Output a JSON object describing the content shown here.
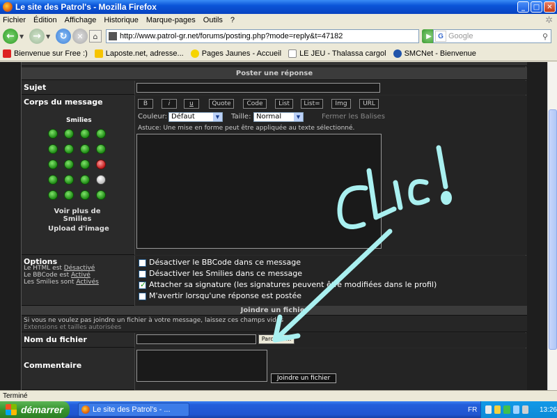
{
  "window": {
    "title": "Le site des Patrol's - Mozilla Firefox"
  },
  "menu": [
    "Fichier",
    "Édition",
    "Affichage",
    "Historique",
    "Marque-pages",
    "Outils",
    "?"
  ],
  "nav": {
    "url": "http://www.patrol-gr.net/forums/posting.php?mode=reply&t=47182",
    "search_placeholder": "Google"
  },
  "bookmarks": [
    {
      "label": "Bienvenue sur Free :)",
      "color": "#d22"
    },
    {
      "label": "Laposte.net, adresse...",
      "color": "#f6c400"
    },
    {
      "label": "Pages Jaunes - Accueil",
      "color": "#f6d400"
    },
    {
      "label": "LE JEU - Thalassa cargol",
      "color": "#eee"
    },
    {
      "label": "SMCNet - Bienvenue",
      "color": "#2255aa"
    }
  ],
  "form": {
    "header": "Poster une réponse",
    "subject_label": "Sujet",
    "body_label": "Corps du message",
    "smilies_title": "Smilies",
    "more_smilies": "Voir plus de Smilies",
    "upload_image": "Upload d'image",
    "bbcode_buttons": [
      "B",
      "i",
      "u",
      "Quote",
      "Code",
      "List",
      "List=",
      "Img",
      "URL"
    ],
    "color_label": "Couleur:",
    "color_value": "Défaut",
    "size_label": "Taille:",
    "size_value": "Normal",
    "close_tags": "Fermer les Balises",
    "tip": "Astuce: Une mise en forme peut être appliquée au texte sélectionné.",
    "options_label": "Options",
    "html_status_prefix": "Le HTML est",
    "html_status": "Désactivé",
    "bbcode_status_prefix": "Le BBCode est",
    "bbcode_status": "Activé",
    "smilies_status_prefix": "Les Smilies sont",
    "smilies_status": "Activés",
    "options": [
      {
        "label": "Désactiver le BBCode dans ce message",
        "checked": false
      },
      {
        "label": "Désactiver les Smilies dans ce message",
        "checked": false
      },
      {
        "label": "Attacher sa signature (les signatures peuvent être modifiées dans le profil)",
        "checked": true
      },
      {
        "label": "M'avertir lorsqu'une réponse est postée",
        "checked": false
      }
    ],
    "attach_header": "Joindre un fichier",
    "attach_info": "Si vous ne voulez pas joindre un fichier à votre message, laissez ces champs vides",
    "attach_ext": "Extensions et tailles autorisées",
    "filename_label": "Nom du fichier",
    "browse_button": "Parcourir...",
    "comment_label": "Commentaire",
    "attach_button": "Joindre un fichier"
  },
  "annotation": {
    "text": "Clic !",
    "color": "#a9f0f0"
  },
  "status": {
    "text": "Terminé"
  },
  "taskbar": {
    "start": "démarrer",
    "task": "Le site des Patrol's - ...",
    "lang": "FR",
    "clock": "13:26"
  }
}
